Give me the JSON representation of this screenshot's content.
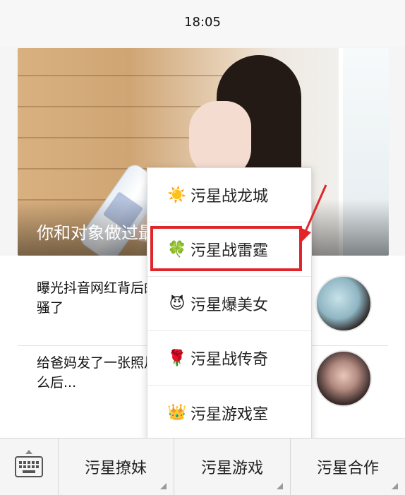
{
  "status_bar": {
    "time": "18:05"
  },
  "hero": {
    "caption": "你和对象做过最浪漫的事是什么？"
  },
  "feed": [
    {
      "text": "曝光抖音网红背后的真面目，哈哈哈很风骚了"
    },
    {
      "text": "给爸妈发了一张照片，看看他们回复了什么后..."
    }
  ],
  "menu": {
    "items": [
      {
        "icon": "sun-icon",
        "emoji": "☀️",
        "label": "污星战龙城"
      },
      {
        "icon": "four-leaf-clover-icon",
        "emoji": "🍀",
        "label": "污星战雷霆"
      },
      {
        "icon": "smiling-devil-icon",
        "emoji": "😈",
        "label": "污星爆美女"
      },
      {
        "icon": "rose-icon",
        "emoji": "🌹",
        "label": "污星战传奇"
      },
      {
        "icon": "crown-icon",
        "emoji": "👑",
        "label": "污星游戏室"
      }
    ],
    "highlighted_index": 1,
    "highlight_color": "#e0262b"
  },
  "bottom_bar": {
    "keyboard_icon": "keyboard-icon",
    "tabs": [
      "污星撩妹",
      "污星游戏",
      "污星合作"
    ]
  }
}
